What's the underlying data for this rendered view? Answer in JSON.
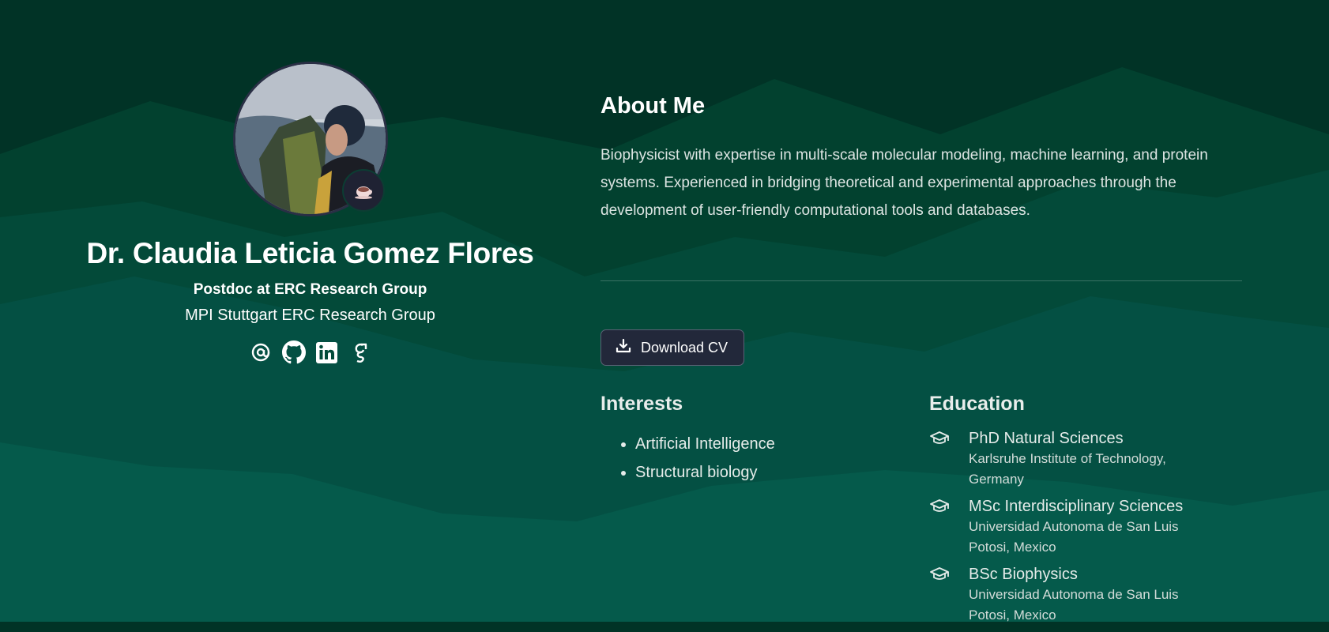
{
  "profile": {
    "name": "Dr. Claudia Leticia Gomez Flores",
    "role": "Postdoc at ERC Research Group",
    "organization": "MPI Stuttgart ERC Research Group",
    "status_icon": "coffee-cup-icon",
    "social": [
      {
        "icon": "email-icon"
      },
      {
        "icon": "github-icon"
      },
      {
        "icon": "linkedin-icon"
      },
      {
        "icon": "google-scholar-icon"
      }
    ]
  },
  "about": {
    "title": "About Me",
    "text": "Biophysicist with expertise in multi-scale molecular modeling, machine learning, and protein systems. Experienced in bridging theoretical and experimental approaches through the development of user-friendly computational tools and databases."
  },
  "cv_button": {
    "label": "Download CV",
    "icon": "download-icon"
  },
  "interests": {
    "title": "Interests",
    "items": [
      "Artificial Intelligence",
      "Structural biology"
    ]
  },
  "education": {
    "title": "Education",
    "items": [
      {
        "degree": "PhD Natural Sciences",
        "institution": "Karlsruhe Institute of Technology, Germany",
        "icon": "graduation-cap-icon"
      },
      {
        "degree": "MSc Interdisciplinary Sciences",
        "institution": "Universidad Autonoma de San Luis Potosi, Mexico",
        "icon": "graduation-cap-icon"
      },
      {
        "degree": "BSc Biophysics",
        "institution": "Universidad Autonoma de San Luis Potosi, Mexico",
        "icon": "graduation-cap-icon"
      }
    ]
  },
  "colors": {
    "background_dark": "#013326",
    "background_light": "#05594c",
    "button_bg": "#22283a",
    "text": "#ffffff"
  }
}
